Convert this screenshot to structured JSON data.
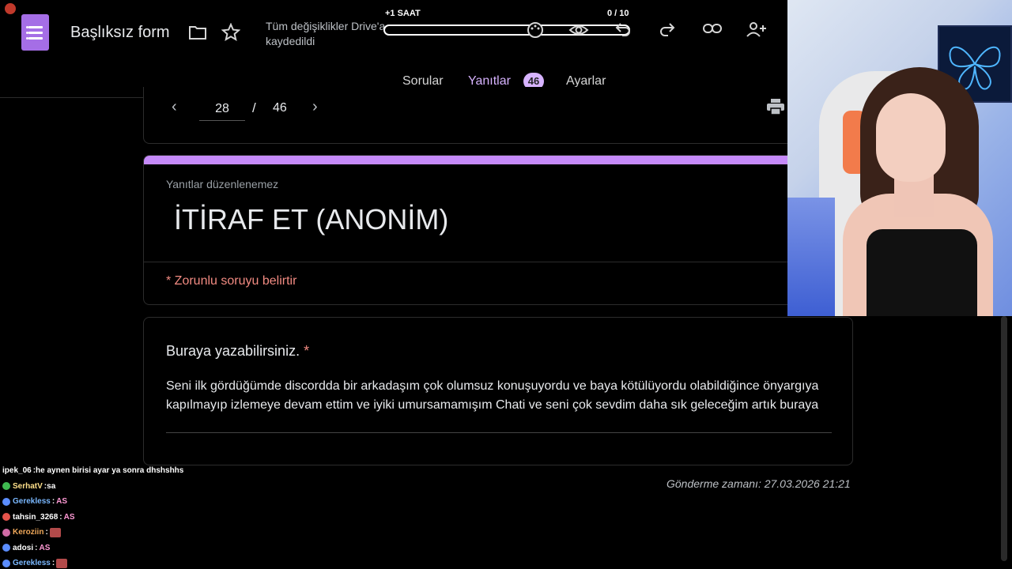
{
  "header": {
    "form_title": "Başlıksız form",
    "save_status": "Tüm değişiklikler Drive'a kaydedildi",
    "icons": [
      "folder-icon",
      "star-icon",
      "palette-icon",
      "eye-icon",
      "undo-icon",
      "redo-icon",
      "link-icon",
      "add-person-icon"
    ]
  },
  "overlay": {
    "left_label": "+1 SAAT",
    "right_label": "0 / 10",
    "progress_fraction": 0.0
  },
  "tabs": [
    {
      "label": "Sorular",
      "active": false
    },
    {
      "label": "Yanıtlar",
      "active": true,
      "badge": "46"
    },
    {
      "label": "Ayarlar",
      "active": false
    }
  ],
  "pager": {
    "current": "28",
    "separator": "/",
    "total": "46"
  },
  "response": {
    "not_editable": "Yanıtlar düzenlenemez",
    "heading": "İTİRAF ET (ANONİM)",
    "required_note": "* Zorunlu soruyu belirtir",
    "question": "Buraya yazabilirsiniz.",
    "question_required_mark": "*",
    "answer": "Seni ilk gördüğümde discordda bir arkadaşım çok olumsuz konuşuyordu ve baya kötülüyordu olabildiğince önyargıya kapılmayıp  izlemeye devam ettim ve  iyiki umursamamışım Chati ve seni çok sevdim daha sık geleceğim artık buraya",
    "submitted_at": "Gönderme zamanı: 27.03.2026 21:21"
  },
  "chat": [
    {
      "user": "ipek_06",
      "color": "#ffffff",
      "badge": "",
      "message": "he aynen birisi ayar ya sonra dhshshhs"
    },
    {
      "user": "SerhatV",
      "color": "#ffe08a",
      "badge": "#3fb950",
      "message": "sa"
    },
    {
      "user": "Gerekless",
      "color": "#7ab8ff",
      "badge": "#5b8dff",
      "message": "AS"
    },
    {
      "user": "tahsin_3268",
      "color": "#ffffff",
      "badge": "#e5534b",
      "message": "AS"
    },
    {
      "user": "Keroziin",
      "color": "#f0a85a",
      "badge": "#d16ba5",
      "message": ""
    },
    {
      "user": "adosi",
      "color": "#ffffff",
      "badge": "#5b8dff",
      "message": "AS"
    },
    {
      "user": "Gerekless",
      "color": "#7ab8ff",
      "badge": "#5b8dff",
      "message": ""
    }
  ],
  "colors": {
    "accent": "#c58af9",
    "tab_active": "#d7b3ff",
    "required": "#f28b82"
  }
}
